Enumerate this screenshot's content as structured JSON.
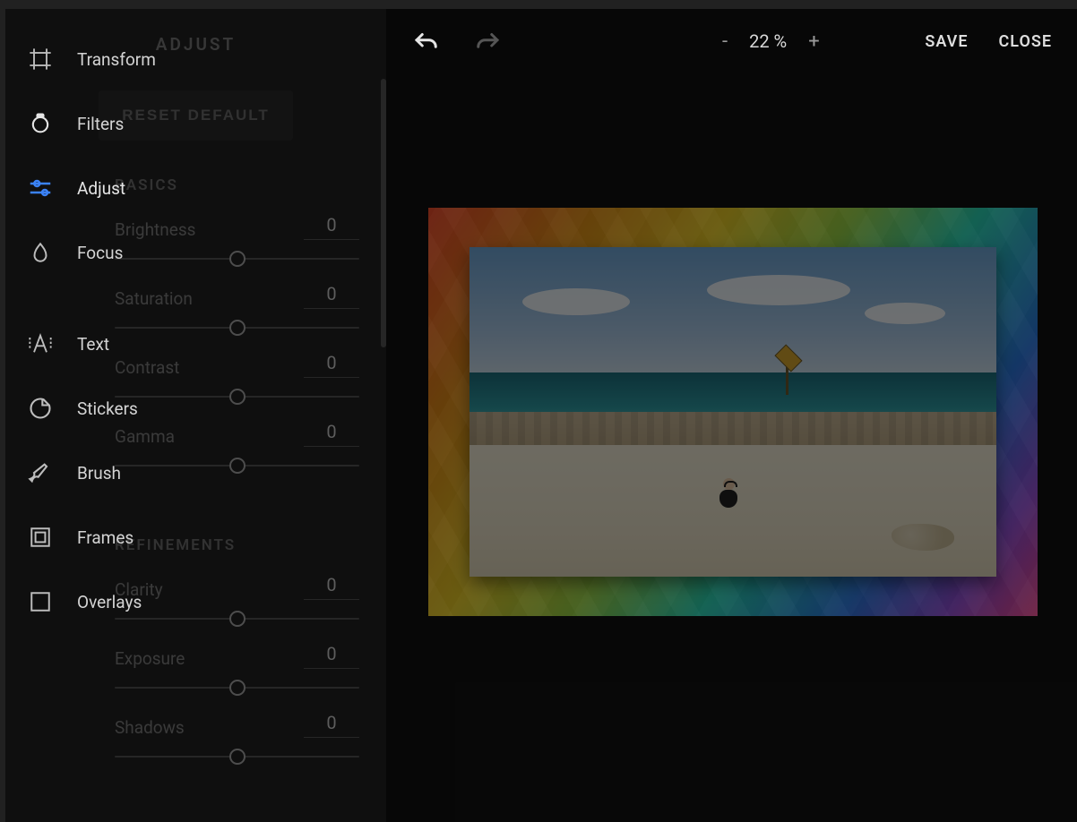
{
  "topbar": {
    "zoom_minus": "-",
    "zoom_value": "22 %",
    "zoom_plus": "+",
    "save": "SAVE",
    "close": "CLOSE"
  },
  "sidebar": {
    "items": [
      {
        "label": "Transform"
      },
      {
        "label": "Filters"
      },
      {
        "label": "Adjust"
      },
      {
        "label": "Focus"
      },
      {
        "label": "Text"
      },
      {
        "label": "Stickers"
      },
      {
        "label": "Brush"
      },
      {
        "label": "Frames"
      },
      {
        "label": "Overlays"
      }
    ],
    "active_index": 2
  },
  "adjust_panel": {
    "title": "ADJUST",
    "reset_label": "RESET DEFAULT",
    "sections": [
      {
        "heading": "BASICS",
        "controls": [
          {
            "label": "Brightness",
            "value": "0"
          },
          {
            "label": "Saturation",
            "value": "0"
          },
          {
            "label": "Contrast",
            "value": "0"
          },
          {
            "label": "Gamma",
            "value": "0"
          }
        ]
      },
      {
        "heading": "REFINEMENTS",
        "controls": [
          {
            "label": "Clarity",
            "value": "0"
          },
          {
            "label": "Exposure",
            "value": "0"
          },
          {
            "label": "Shadows",
            "value": "0"
          }
        ]
      }
    ]
  }
}
